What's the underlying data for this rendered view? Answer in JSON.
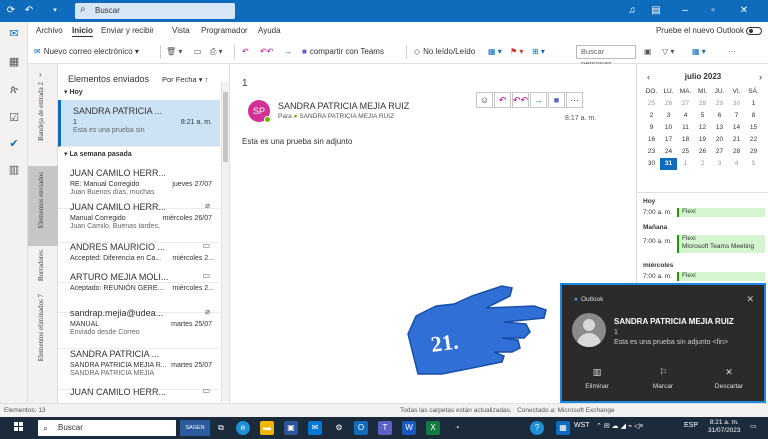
{
  "titlebar": {
    "search_placeholder": "Buscar"
  },
  "menu": {
    "items": [
      "Archivo",
      "Inicio",
      "Enviar y recibir",
      "Vista",
      "Programador",
      "Ayuda"
    ],
    "toggle_label": "Pruebe el nuevo Outlook"
  },
  "ribbon": {
    "new_email": "Nuevo correo electrónico",
    "share_teams": "compartir con Teams",
    "read_unread": "No leído/Leído",
    "search_people": "Buscar personas"
  },
  "folderpane": {
    "labels": [
      "Bandeja de entrada 2",
      "Elementos enviados",
      "Borradores",
      "Elementos eliminados 7"
    ]
  },
  "msglist": {
    "folder_title": "Elementos enviados",
    "sort": "Por Fecha",
    "group_today": "Hoy",
    "group_lastweek": "La semana pasada",
    "messages": [
      {
        "from": "SANDRA PATRICIA ...",
        "subject": "1",
        "preview": "Esta es una prueba sin",
        "date": "8:21 a. m."
      },
      {
        "from": "JUAN CAMILO HERR...",
        "subject": "RE: Manual Corregido",
        "preview": "Juan Buenos días, muchas",
        "date": "jueves 27/07"
      },
      {
        "from": "JUAN CAMILO HERR...",
        "subject": "Manual Corregido",
        "preview": "Juan Camilo, Buenas tardes,",
        "date": "miércoles 26/07"
      },
      {
        "from": "ANDRES MAURICIO ...",
        "subject": "Accepted: Diferencia en Ca...",
        "preview": "",
        "date": "miércoles 2..."
      },
      {
        "from": "ARTURO MEJIA MOLI...",
        "subject": "Aceptado: REUNIÓN GERE...",
        "preview": "",
        "date": "miércoles 2..."
      },
      {
        "from": "sandrap.mejia@udea...",
        "subject": "MANUAL",
        "preview": "Enviado desde Correo",
        "date": "martes 25/07"
      },
      {
        "from": "SANDRA PATRICIA ...",
        "subject": "SANDRA PATRICIA MEJIA R...",
        "preview": "SANDRA PATRICIA MEJIA",
        "date": "martes 25/07"
      },
      {
        "from": "JUAN CAMILO HERR...",
        "subject": "",
        "preview": "",
        "date": ""
      }
    ]
  },
  "reading": {
    "count": "1",
    "avatar_initials": "SP",
    "from": "SANDRA PATRICIA MEJIA RUIZ",
    "to_label": "Para",
    "to": "SANDRA PATRICIA MEJIA RUIZ",
    "time": "8:17 a. m.",
    "body": "Esta es una prueba sin adjunto"
  },
  "calendar": {
    "month": "julio 2023",
    "weekdays": [
      "DO.",
      "LU.",
      "MA.",
      "MI.",
      "JU.",
      "VI.",
      "SÁ."
    ],
    "weeks": [
      [
        "25",
        "26",
        "27",
        "28",
        "29",
        "30",
        "1"
      ],
      [
        "2",
        "3",
        "4",
        "5",
        "6",
        "7",
        "8"
      ],
      [
        "9",
        "10",
        "11",
        "12",
        "13",
        "14",
        "15"
      ],
      [
        "16",
        "17",
        "18",
        "19",
        "20",
        "21",
        "22"
      ],
      [
        "23",
        "24",
        "25",
        "26",
        "27",
        "28",
        "29"
      ],
      [
        "30",
        "31",
        "1",
        "2",
        "3",
        "4",
        "5"
      ]
    ],
    "today_label": "Hoy",
    "tomorrow_label": "Mañana",
    "wednesday_label": "miércoles",
    "event_time": "7:00 a. m.",
    "event_flexi": "Flexi",
    "event_teams": "Microsoft Teams Meeting"
  },
  "statusbar": {
    "items": "Elementos: 13",
    "sync": "Todas las carpetas están actualizadas.",
    "connection": "Conectado a: Microsoft Exchange"
  },
  "toast": {
    "app": "Outlook",
    "sender": "SANDRA PATRICIA MEJIA RUIZ",
    "count": "1",
    "body": "Esta es una prueba sin adjunto  <fin>",
    "btn_delete": "Eliminar",
    "btn_flag": "Marcar",
    "btn_dismiss": "Descartar"
  },
  "overlay": {
    "step_number": "21."
  },
  "taskbar": {
    "search": "Buscar",
    "badge": "SAGEN",
    "tray_label": "WST",
    "lang": "ESP",
    "time": "8:21 a. m.",
    "date": "31/07/2023"
  },
  "colors": {
    "brand": "#0f6cbd",
    "selected": "#cce3f5",
    "toast_border": "#1e88e5",
    "hand": "#2f6fd6"
  }
}
